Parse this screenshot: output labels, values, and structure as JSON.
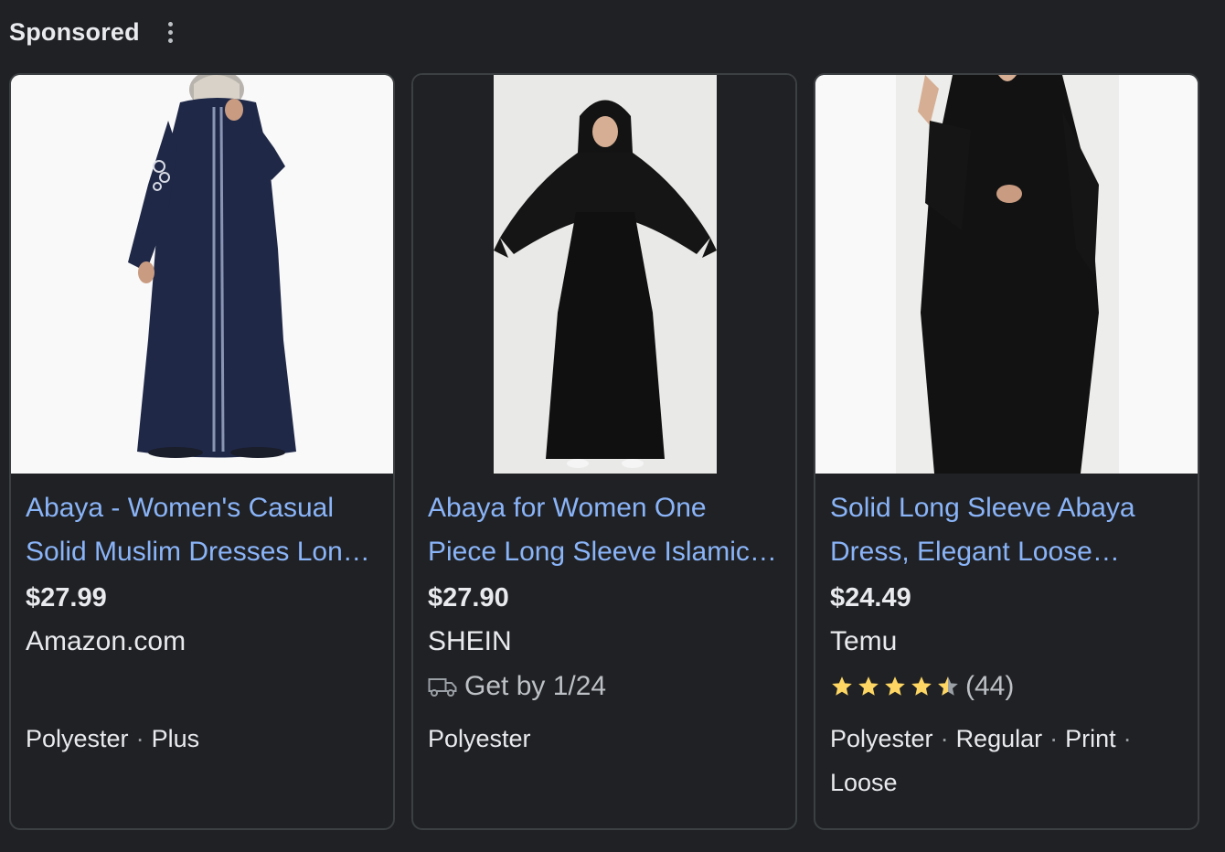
{
  "header": {
    "label": "Sponsored",
    "menu_icon": "more-vert-icon"
  },
  "products": [
    {
      "title": "Abaya - Women's Casual Solid Muslim Dresses Long Sleeve",
      "price": "$27.99",
      "merchant": "Amazon.com",
      "attributes": [
        "Polyester",
        "Plus"
      ],
      "image_color": "#1c2340"
    },
    {
      "title": "Abaya for Women One Piece Long Sleeve Islamic Prayer Dress",
      "price": "$27.90",
      "merchant": "SHEIN",
      "delivery": "Get by 1/24",
      "delivery_icon": "truck-icon",
      "attributes": [
        "Polyester"
      ],
      "image_color": "#121212"
    },
    {
      "title": "Solid Long Sleeve Abaya Dress, Elegant Loose Muslim Dress",
      "price": "$24.49",
      "merchant": "Temu",
      "rating": 4.5,
      "rating_count": "(44)",
      "star_color": "#fdd663",
      "attributes": [
        "Polyester",
        "Regular",
        "Print",
        "Loose"
      ],
      "image_color": "#0f0f0f"
    }
  ]
}
